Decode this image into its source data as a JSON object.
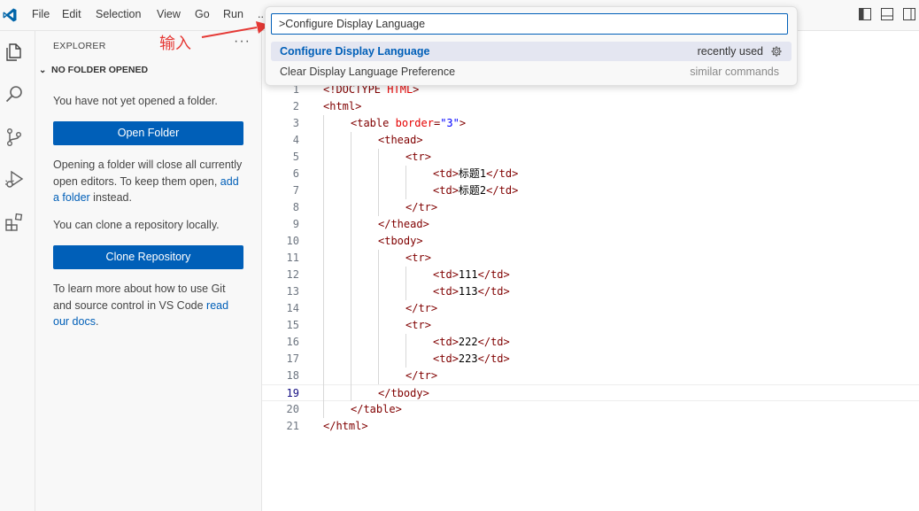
{
  "menu": [
    "File",
    "Edit",
    "Selection",
    "View",
    "Go",
    "Run",
    "..."
  ],
  "explorer": {
    "title": "EXPLORER",
    "more": "···",
    "folder_header": "NO FOLDER OPENED",
    "no_folder_text": "You have not yet opened a folder.",
    "open_folder_button": "Open Folder",
    "closing_text_1": "Opening a folder will close all currently open editors. To keep them open, ",
    "closing_link": "add a folder",
    "closing_text_2": " instead.",
    "clone_text": "You can clone a repository locally.",
    "clone_button": "Clone Repository",
    "git_text": "To learn more about how to use Git and source control in VS Code ",
    "git_link": "read our docs",
    "git_end": "."
  },
  "palette": {
    "input_value": ">Configure Display Language",
    "items": [
      {
        "label": "Configure Display Language",
        "desc": "recently used"
      },
      {
        "label": "Clear Display Language Preference",
        "desc": "similar commands"
      }
    ]
  },
  "annotation": {
    "text": "输入",
    "color": "#e53935"
  },
  "editor": {
    "active_line": 19,
    "lines": [
      {
        "n": "1",
        "indent": 0,
        "text": "<!DOCTYPE HTML>"
      },
      {
        "n": "2",
        "indent": 0,
        "text": "<html>"
      },
      {
        "n": "3",
        "indent": 1,
        "text": "<table border=\"3\">"
      },
      {
        "n": "4",
        "indent": 2,
        "text": "<thead>"
      },
      {
        "n": "5",
        "indent": 3,
        "text": "<tr>"
      },
      {
        "n": "6",
        "indent": 4,
        "text": "<td>标题1</td>"
      },
      {
        "n": "7",
        "indent": 4,
        "text": "<td>标题2</td>"
      },
      {
        "n": "8",
        "indent": 3,
        "text": "</tr>"
      },
      {
        "n": "9",
        "indent": 2,
        "text": "</thead>"
      },
      {
        "n": "10",
        "indent": 2,
        "text": "<tbody>"
      },
      {
        "n": "11",
        "indent": 3,
        "text": "<tr>"
      },
      {
        "n": "12",
        "indent": 4,
        "text": "<td>111</td>"
      },
      {
        "n": "13",
        "indent": 4,
        "text": "<td>113</td>"
      },
      {
        "n": "14",
        "indent": 3,
        "text": "</tr>"
      },
      {
        "n": "15",
        "indent": 3,
        "text": "<tr>"
      },
      {
        "n": "16",
        "indent": 4,
        "text": "<td>222</td>"
      },
      {
        "n": "17",
        "indent": 4,
        "text": "<td>223</td>"
      },
      {
        "n": "18",
        "indent": 3,
        "text": "</tr>"
      },
      {
        "n": "19",
        "indent": 2,
        "text": "</tbody>"
      },
      {
        "n": "20",
        "indent": 1,
        "text": "</table>"
      },
      {
        "n": "21",
        "indent": 0,
        "text": "</html>"
      }
    ]
  },
  "colors": {
    "accent": "#005fb8",
    "tag": "#800000",
    "attr": "#e50000",
    "value": "#0000ff"
  },
  "icons": [
    "vscode-logo-icon",
    "explorer-icon",
    "search-icon",
    "source-control-icon",
    "run-debug-icon",
    "extensions-icon",
    "gear-icon",
    "toggle-sidebar-icon",
    "toggle-panel-icon",
    "toggle-secondary-sidebar-icon"
  ]
}
